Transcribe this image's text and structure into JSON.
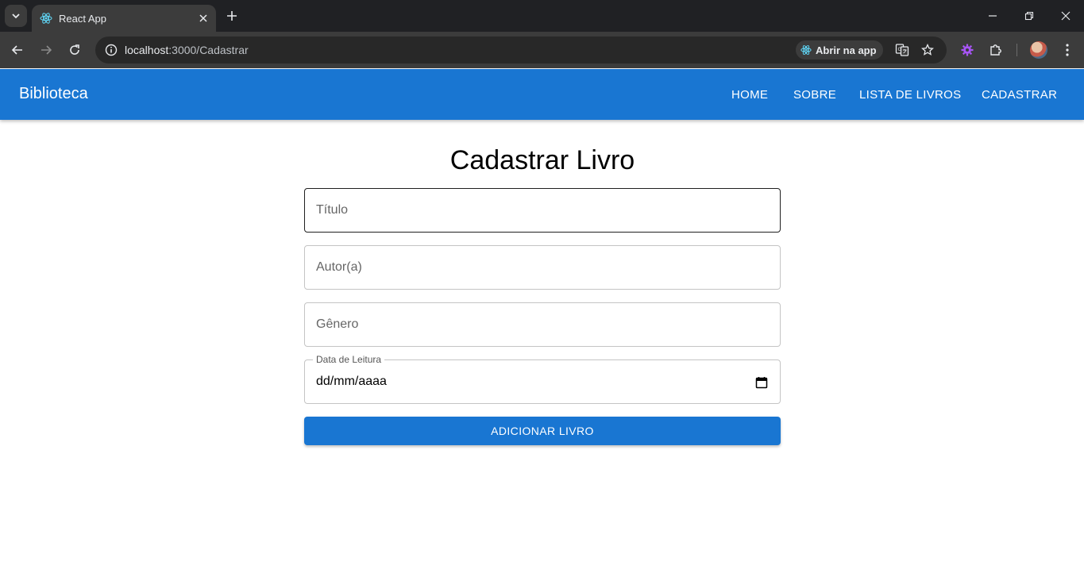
{
  "browser": {
    "tab_title": "React App",
    "url_host": "localhost",
    "url_path": ":3000/Cadastrar",
    "open_app_label": "Abrir na app"
  },
  "appbar": {
    "brand": "Biblioteca",
    "nav": [
      "HOME",
      "SOBRE",
      "LISTA DE LIVROS",
      "CADASTRAR"
    ],
    "color": "#1976d2"
  },
  "form": {
    "title": "Cadastrar Livro",
    "fields": {
      "titulo": {
        "placeholder": "Título"
      },
      "autor": {
        "placeholder": "Autor(a)"
      },
      "genero": {
        "placeholder": "Gênero"
      },
      "data": {
        "label": "Data de Leitura",
        "value": "dd/mm/aaaa"
      }
    },
    "submit_label": "ADICIONAR LIVRO"
  }
}
